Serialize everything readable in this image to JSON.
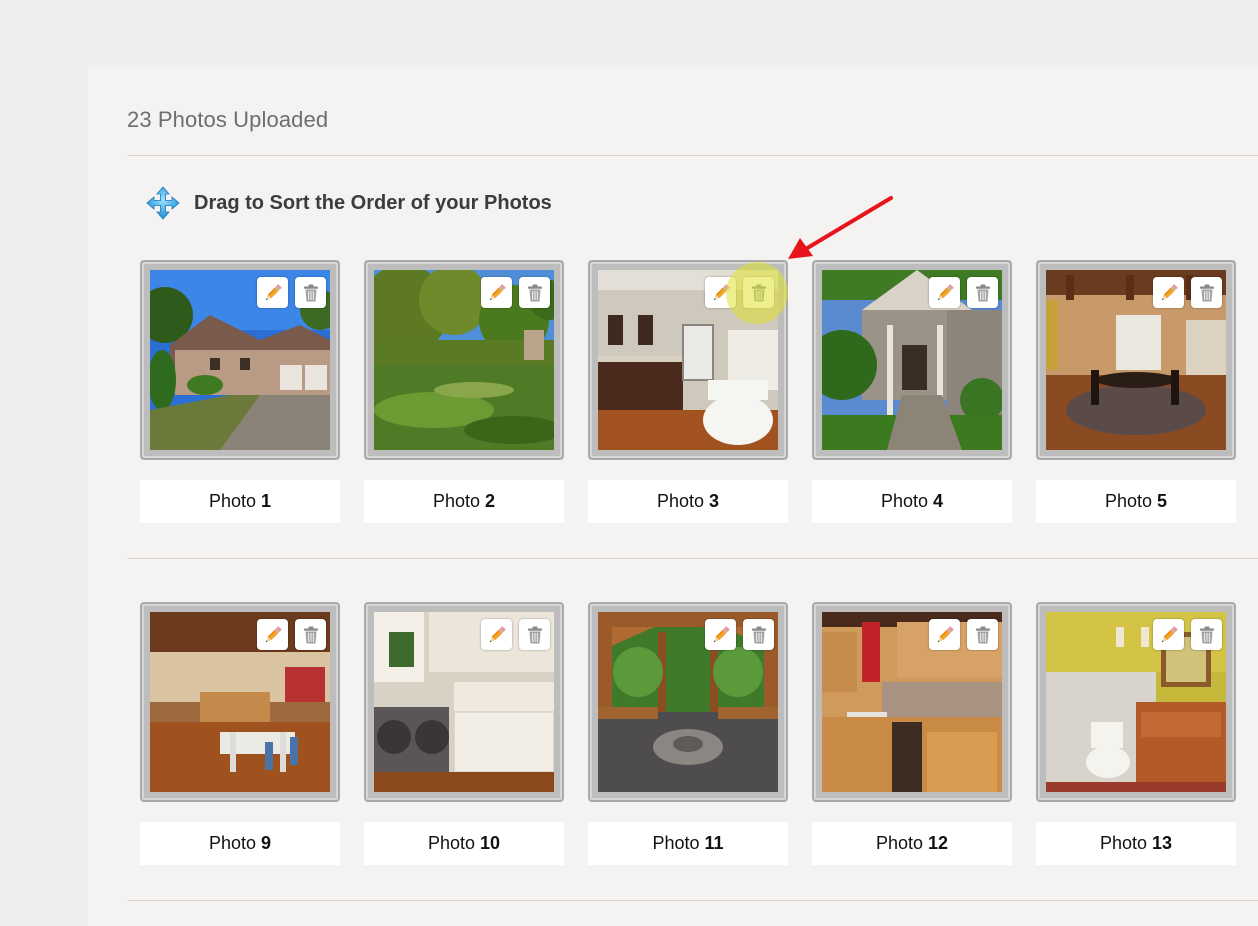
{
  "header": {
    "uploaded_text": "23 Photos Uploaded"
  },
  "sort": {
    "title": "Drag to Sort the Order of your Photos",
    "icon": "move-arrows-icon"
  },
  "photo_word": "Photo",
  "rows": [
    [
      {
        "num": "1",
        "scene": "house-exterior"
      },
      {
        "num": "2",
        "scene": "yard"
      },
      {
        "num": "3",
        "scene": "bathroom"
      },
      {
        "num": "4",
        "scene": "entry-porch"
      },
      {
        "num": "5",
        "scene": "dining-room"
      }
    ],
    [
      {
        "num": "9",
        "scene": "kitchen-dining"
      },
      {
        "num": "10",
        "scene": "laundry"
      },
      {
        "num": "11",
        "scene": "gazebo"
      },
      {
        "num": "12",
        "scene": "kitchen"
      },
      {
        "num": "13",
        "scene": "powder-room"
      }
    ]
  ],
  "icons": {
    "edit": "pencil-icon",
    "delete": "trash-icon"
  },
  "colors": {
    "highlight": "#dee22d",
    "annotation_arrow": "#e8141b"
  }
}
